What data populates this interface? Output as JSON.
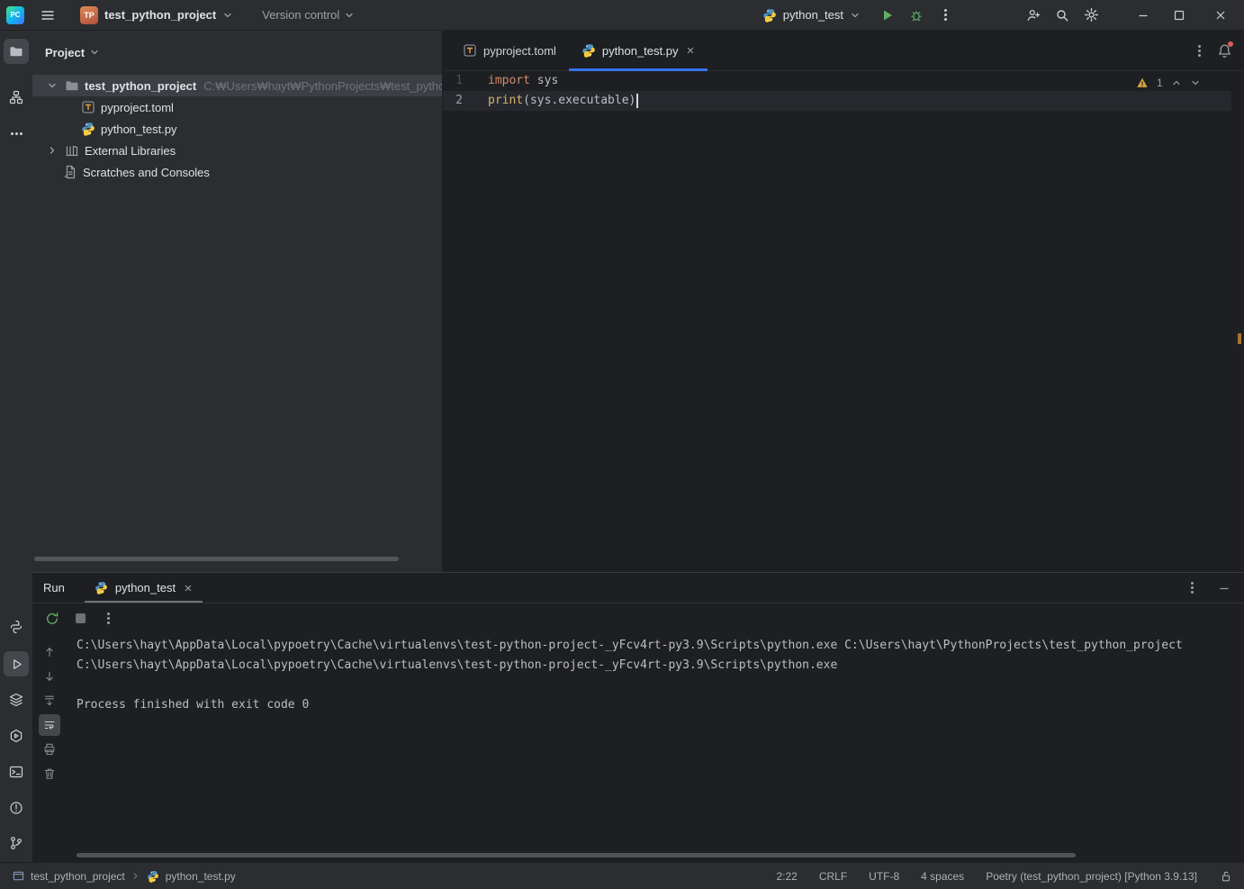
{
  "colors": {
    "accent_blue": "#3574f0",
    "run_green": "#5fad65",
    "warning_orange": "#d9a343",
    "keyword": "#cf8e6d",
    "builtin": "#d8b36c",
    "panel_bg": "#2b2d30",
    "editor_bg": "#1e1f22"
  },
  "icons": {
    "menu": "hamburger",
    "run": "play-triangle",
    "debug": "bug",
    "search": "magnifier",
    "settings": "gear",
    "notifications": "bell-with-red-dot",
    "warning": "yellow-triangle"
  },
  "title_bar": {
    "app_icon": "PC",
    "project_badge": "TP",
    "project_name": "test_python_project",
    "version_control": "Version control",
    "run_config_name": "python_test"
  },
  "project_panel": {
    "title": "Project",
    "root_label": "test_python_project",
    "root_path": "C:₩Users₩hayt₩PythonProjects₩test_python_...",
    "items": {
      "pyproject": "pyproject.toml",
      "python_test": "python_test.py",
      "external_libraries": "External Libraries",
      "scratches": "Scratches and Consoles"
    }
  },
  "editor": {
    "tabs": [
      {
        "label": "pyproject.toml"
      },
      {
        "label": "python_test.py"
      }
    ],
    "gutter": [
      "1",
      "2"
    ],
    "code": {
      "line1_keyword": "import",
      "line1_rest": " sys",
      "line2_builtin": "print",
      "line2_open": "(",
      "line2_arg": "sys.executable",
      "line2_close": ")"
    },
    "warning_count": "1"
  },
  "run_panel": {
    "title": "Run",
    "tab_label": "python_test",
    "console_lines": [
      "C:\\Users\\hayt\\AppData\\Local\\pypoetry\\Cache\\virtualenvs\\test-python-project-_yFcv4rt-py3.9\\Scripts\\python.exe C:\\Users\\hayt\\PythonProjects\\test_python_project",
      "C:\\Users\\hayt\\AppData\\Local\\pypoetry\\Cache\\virtualenvs\\test-python-project-_yFcv4rt-py3.9\\Scripts\\python.exe",
      "",
      "Process finished with exit code 0"
    ]
  },
  "status_bar": {
    "breadcrumb_project": "test_python_project",
    "breadcrumb_file": "python_test.py",
    "cursor_position": "2:22",
    "line_separator": "CRLF",
    "encoding": "UTF-8",
    "indent": "4 spaces",
    "interpreter": "Poetry (test_python_project) [Python 3.9.13]"
  }
}
